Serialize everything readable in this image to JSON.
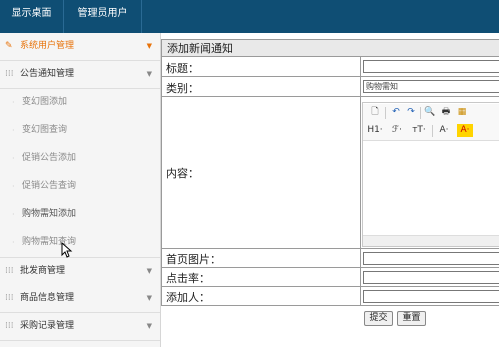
{
  "topnav": {
    "items": [
      "显示桌面",
      "管理员用户"
    ]
  },
  "sidebar": {
    "sections": [
      {
        "label": "系统用户管理",
        "active": true,
        "icon": "pencil-icon"
      },
      {
        "label": "公告通知管理",
        "active": false,
        "icon": "grid-icon"
      },
      {
        "label": "批发商管理",
        "active": false,
        "icon": "grid-icon"
      },
      {
        "label": "商品信息管理",
        "active": false,
        "icon": "grid-icon"
      },
      {
        "label": "采购记录管理",
        "active": false,
        "icon": "grid-icon"
      }
    ],
    "subitems": [
      "变幻图添加",
      "变幻图查询",
      "促销公告添加",
      "促销公告查询",
      "购物需知添加",
      "购物需知查询"
    ]
  },
  "form": {
    "title": "添加新闻通知",
    "fields": {
      "title_label": "标题：",
      "category_label": "类别：",
      "category_value": "购物需知",
      "content_label": "内容：",
      "image_label": "首页图片：",
      "clicks_label": "点击率：",
      "author_label": "添加人："
    },
    "editor_toolbar": {
      "row1": [
        "🗋",
        "↶",
        "↷",
        "🔍",
        "🖶",
        "▦"
      ],
      "row2": [
        "H1·",
        "ℱ·",
        "тT·",
        "A·",
        "A·"
      ]
    },
    "buttons": {
      "submit": "提交",
      "reset": "重置"
    }
  },
  "colors": {
    "topbar": "#0f4e74",
    "accent": "#e8730a",
    "highlight": "#ffd400"
  }
}
